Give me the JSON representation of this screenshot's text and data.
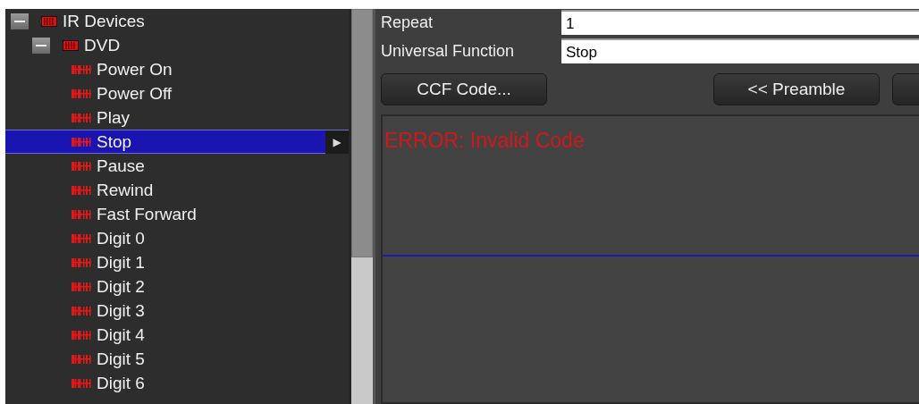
{
  "tree": [
    {
      "label": "IR Devices",
      "expanded": true,
      "children": [
        {
          "label": "DVD",
          "expanded": true,
          "children": [
            {
              "label": "Power On",
              "selected": false
            },
            {
              "label": "Power Off",
              "selected": false
            },
            {
              "label": "Play",
              "selected": false
            },
            {
              "label": "Stop",
              "selected": true,
              "arrow": "▶"
            },
            {
              "label": "Pause",
              "selected": false
            },
            {
              "label": "Rewind",
              "selected": false
            },
            {
              "label": "Fast Forward",
              "selected": false
            },
            {
              "label": "Digit 0",
              "selected": false
            },
            {
              "label": "Digit 1",
              "selected": false
            },
            {
              "label": "Digit 2",
              "selected": false
            },
            {
              "label": "Digit 3",
              "selected": false
            },
            {
              "label": "Digit 4",
              "selected": false
            },
            {
              "label": "Digit 5",
              "selected": false
            },
            {
              "label": "Digit 6",
              "selected": false
            }
          ]
        }
      ]
    }
  ],
  "form": [
    {
      "label": "Repeat",
      "value": "1"
    },
    {
      "label": "Universal Function",
      "value": "Stop"
    }
  ],
  "buttons": [
    {
      "label": "CCF Code..."
    },
    {
      "label": "<< Preamble"
    }
  ],
  "output": {
    "message": "ERROR: Invalid Code"
  }
}
